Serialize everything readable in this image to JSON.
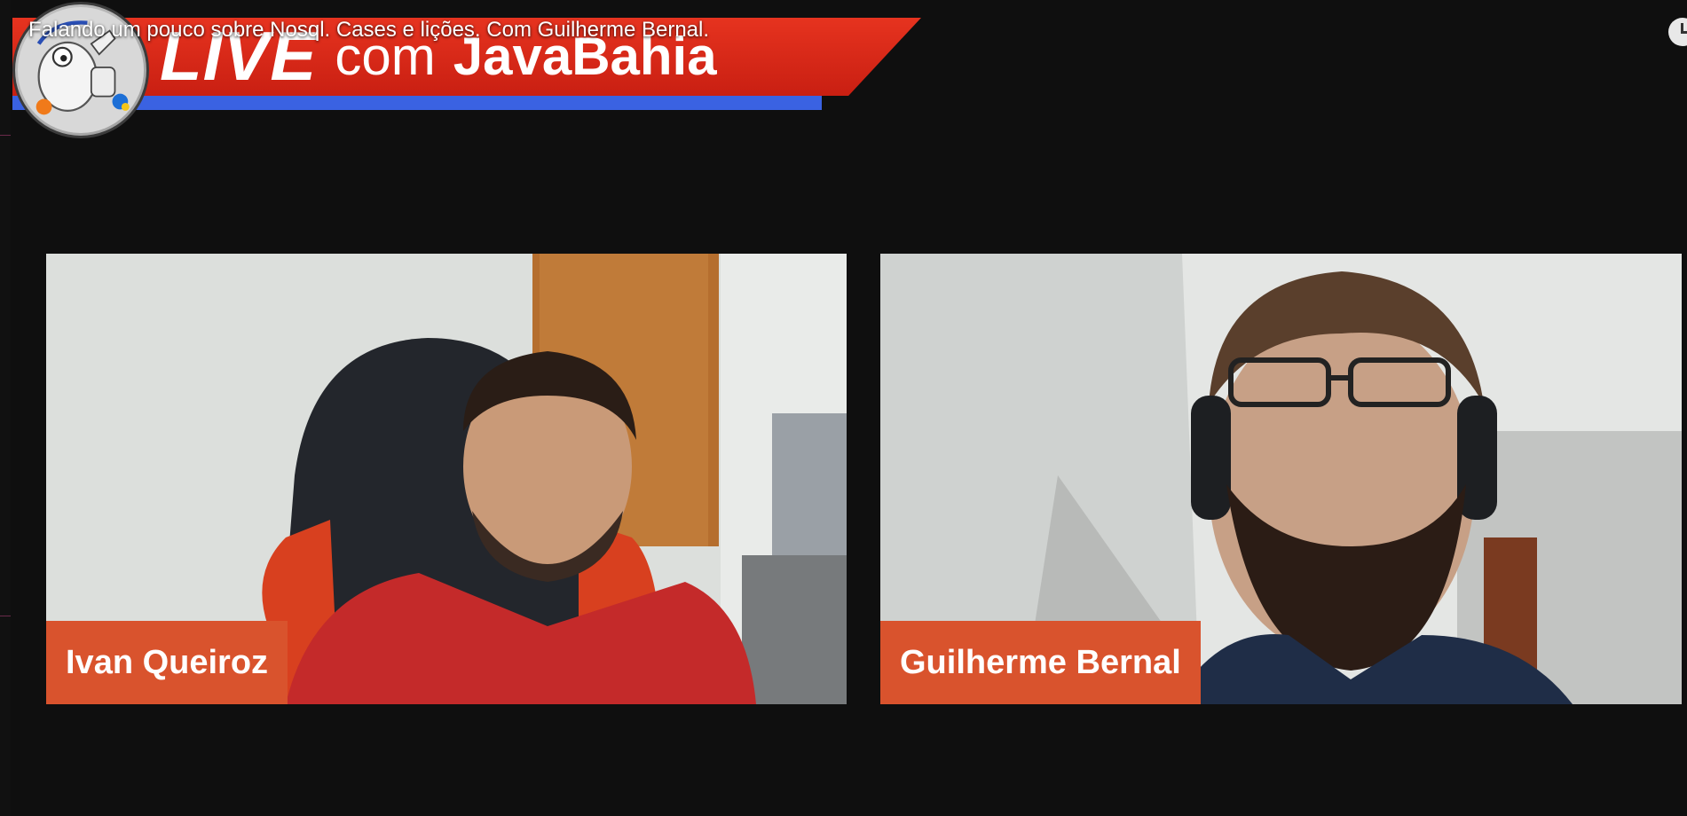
{
  "video": {
    "title": "Falando um pouco sobre Nosql. Cases e lições. Com Guilherme Bernal."
  },
  "banner": {
    "live": "LIVE",
    "com": "com",
    "channel": "JavaBahia"
  },
  "participants": [
    {
      "name": "Ivan Queiroz"
    },
    {
      "name": "Guilherme Bernal"
    }
  ],
  "icons": {
    "top_right": "clock-icon",
    "logo": "javabahia-logo"
  },
  "colors": {
    "banner_red": "#d92a18",
    "banner_blue": "#3a62e2",
    "nameplate": "#d9532d",
    "background": "#0f0f0f"
  }
}
